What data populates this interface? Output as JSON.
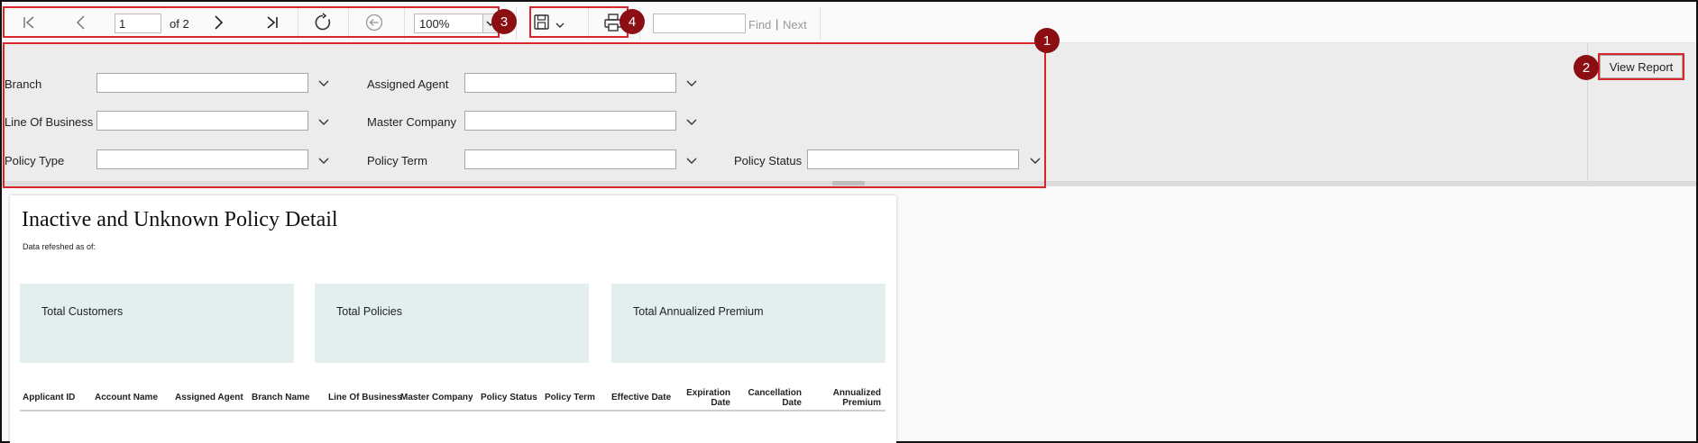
{
  "toolbar": {
    "page_current": "1",
    "page_of": "of 2",
    "zoom": "100%",
    "find_placeholder": "",
    "find_label": "Find",
    "find_pipe": "|",
    "next_label": "Next"
  },
  "params": {
    "branch_label": "Branch",
    "assigned_agent_label": "Assigned Agent",
    "line_of_business_label": "Line Of Business",
    "master_company_label": "Master Company",
    "policy_type_label": "Policy Type",
    "policy_term_label": "Policy Term",
    "policy_status_label": "Policy Status",
    "view_report_label": "View Report"
  },
  "annotations": {
    "badge_1": "1",
    "badge_2": "2",
    "badge_3": "3",
    "badge_4": "4"
  },
  "report": {
    "title": "Inactive and Unknown Policy Detail",
    "refreshed": "Data refeshed as of:",
    "kpis": [
      "Total Customers",
      "Total Policies",
      "Total Annualized Premium"
    ],
    "columns": {
      "applicant_id": "Applicant ID",
      "account_name": "Account Name",
      "assigned_agent": "Assigned Agent",
      "branch_name": "Branch Name",
      "line_of_business": "Line Of Business",
      "master_company": "Master Company",
      "policy_status": "Policy Status",
      "policy_term": "Policy Term",
      "effective_date": "Effective Date",
      "expiration_1": "Expiration",
      "expiration_2": "Date",
      "cancellation_1": "Cancellation",
      "cancellation_2": "Date",
      "annualized_1": "Annualized",
      "annualized_2": "Premium"
    }
  },
  "colors": {
    "annotation_red": "#d9262c",
    "badge_fill": "#8b0e13",
    "kpi_fill": "#e2efee",
    "panel_bg": "#ececec"
  }
}
